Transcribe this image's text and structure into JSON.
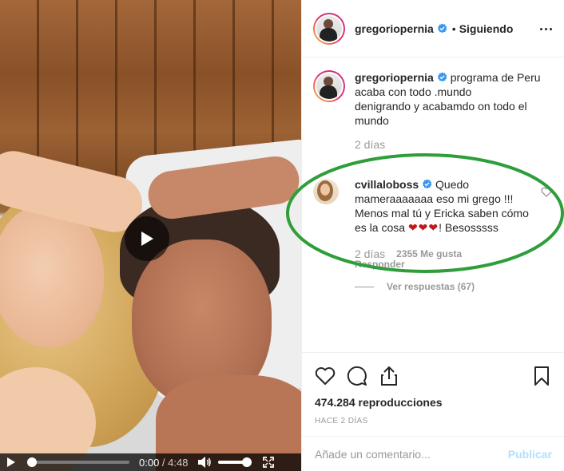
{
  "post": {
    "author": {
      "username": "gregoriopernia",
      "verified": true,
      "avatar_icon": "profile-photo-man",
      "follow_status": "Siguiendo",
      "separator": "•"
    },
    "caption": {
      "line1": "programa de Peru acaba con todo .mundo",
      "line2": "denigrando y acabamdo on todo el mundo",
      "age": "2 días"
    },
    "comments": [
      {
        "username": "cvillaloboss",
        "verified": true,
        "avatar_icon": "profile-photo-woman",
        "text": "Quedo mameraaaaaaa eso mi grego !!! Menos mal tú y Ericka saben cómo es la cosa",
        "hearts": "❤❤❤",
        "text_end": "! Besosssss",
        "age": "2 días",
        "likes": "2355 Me gusta",
        "reply_label": "Responder",
        "highlighted": true,
        "highlight_color": "#2e9e3a"
      }
    ],
    "view_replies": "Ver respuestas (67)",
    "views": "474.284 reproducciones",
    "posted": "Hace 2 días",
    "comment_placeholder": "Añade un comentario...",
    "publish_label": "Publicar"
  },
  "video": {
    "current_time": "0:00",
    "separator": " / ",
    "duration": "4:48",
    "progress": 0.0,
    "volume": 1.0
  },
  "colors": {
    "verified_blue": "#3897f0",
    "text_primary": "#262626",
    "text_secondary": "#999999",
    "publish_disabled": "#b2dffc"
  }
}
